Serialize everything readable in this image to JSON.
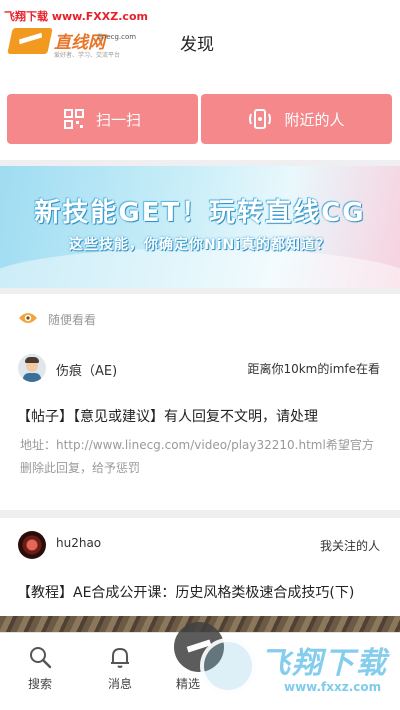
{
  "watermark": {
    "top_text": "飞翔下载 www.FXXZ.com",
    "logo_text": "飞翔下载",
    "logo_url": "www.fxxz.com"
  },
  "header": {
    "logo_text": "直线网",
    "logo_domain": "linecg.com",
    "logo_slogan": "爱好者、学习、交流平台",
    "title": "发现"
  },
  "actions": [
    {
      "label": "扫一扫",
      "icon": "qr-scan-icon"
    },
    {
      "label": "附近的人",
      "icon": "nearby-signal-icon"
    }
  ],
  "banner": {
    "title": "新技能GET！玩转直线CG",
    "subtitle": "这些技能，你确定你NiNi真的都知道？"
  },
  "section": {
    "label": "随便看看",
    "icon": "eye-icon"
  },
  "posts": [
    {
      "user": "伤痕（AE)",
      "meta": "距离你10km的imfe在看",
      "title": "【帖子】【意见或建议】有人回复不文明，请处理",
      "body": "地址：http://www.linecg.com/video/play32210.html希望官方删除此回复，给予惩罚"
    },
    {
      "user": "hu2hao",
      "meta": "我关注的人",
      "title": "【教程】AE合成公开课：历史风格类极速合成技巧(下)"
    }
  ],
  "tabbar": {
    "items": [
      {
        "label": "搜索",
        "icon": "search-icon"
      },
      {
        "label": "消息",
        "icon": "bell-icon"
      },
      {
        "label": "精选",
        "icon": "featured-icon"
      }
    ]
  },
  "colors": {
    "accent": "#f4888b",
    "background": "#efeff2"
  }
}
